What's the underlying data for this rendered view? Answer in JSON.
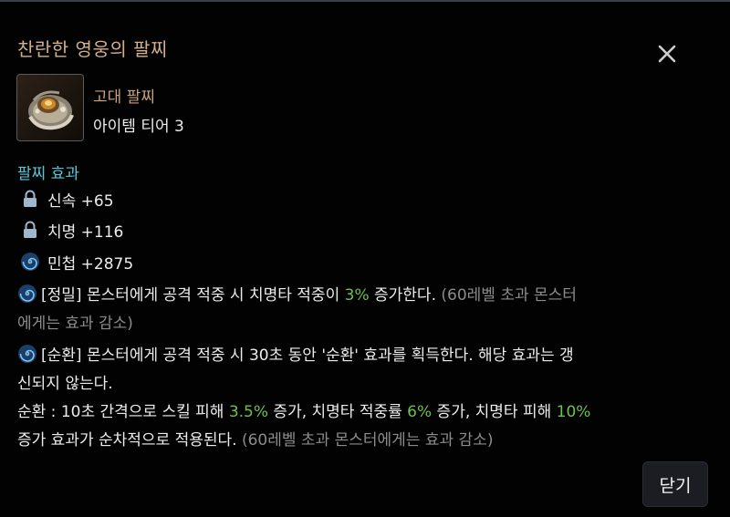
{
  "dialog": {
    "title": "찬란한 영웅의 팔찌",
    "close_icon": "close-icon",
    "close_button_label": "닫기"
  },
  "item": {
    "icon": "bracelet-icon",
    "grade": "고대 팔찌",
    "tier": "아이템 티어 3"
  },
  "effects": {
    "section_title": "팔찌 효과",
    "stats": [
      {
        "icon": "lock-icon",
        "text": "신속 +65"
      },
      {
        "icon": "lock-icon",
        "text": "치명 +116"
      },
      {
        "icon": "spiral-icon",
        "text": "민첩 +2875"
      }
    ],
    "precision": {
      "icon": "spiral-icon",
      "prefix": "[정밀] 몬스터에게 공격 적중 시 치명타 적중이 ",
      "value": "3%",
      "suffix": " 증가한다.",
      "note_line1": " (60레벨 초과 몬스터",
      "note_line2": "에게는 효과 감소)"
    },
    "cycle": {
      "icon": "spiral-icon",
      "text_line1": "[순환] 몬스터에게 공격 적중 시 30초 동안 '순환' 효과를 획득한다. 해당 효과는 갱",
      "text_line2": "신되지 않는다.",
      "detail_a": "순환 : 10초 간격으로 스킬 피해 ",
      "value_a": "3.5%",
      "detail_b": " 증가, 치명타 적중률 ",
      "value_b": "6%",
      "detail_c": " 증가, 치명타 피해 ",
      "value_c": "10%",
      "detail_d": "증가 효과가 순차적으로 적용된다.",
      "note": " (60레벨 초과 몬스터에게는 효과 감소)"
    }
  },
  "colors": {
    "title": "#d4b08a",
    "grade": "#c9a27a",
    "section": "#5cc6d8",
    "highlight": "#6cc24a",
    "dim": "#8c8c8c"
  }
}
